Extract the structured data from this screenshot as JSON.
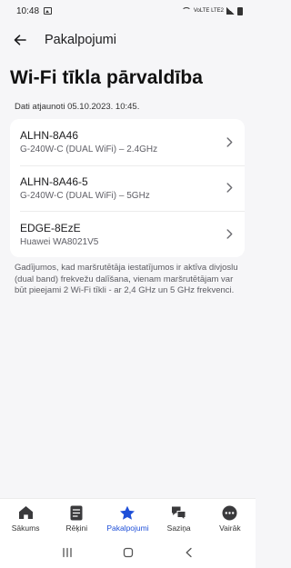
{
  "status_bar": {
    "time": "10:48",
    "network_label": "VoLTE LTE2"
  },
  "app_bar": {
    "title": "Pakalpojumi"
  },
  "page": {
    "title": "Wi-Fi tīkla pārvaldība",
    "updated": "Dati atjaunoti 05.10.2023. 10:45."
  },
  "networks": [
    {
      "name": "ALHN-8A46",
      "desc": "G-240W-C (DUAL WiFi) – 2.4GHz"
    },
    {
      "name": "ALHN-8A46-5",
      "desc": "G-240W-C (DUAL WiFi) – 5GHz"
    },
    {
      "name": "EDGE-8EzE",
      "desc": "Huawei WA8021V5"
    }
  ],
  "info_text": "Gadījumos, kad maršrutētāja iestatījumos ir aktīva divjoslu (dual band) frekvežu dalīšana, vienam maršrutētājam var būt pieejami 2 Wi-Fi tīkli - ar 2,4 GHz un 5 GHz frekvenci.",
  "bottom_nav": {
    "items": [
      {
        "label": "Sākums",
        "icon": "home-icon"
      },
      {
        "label": "Rēķini",
        "icon": "document-icon"
      },
      {
        "label": "Pakalpojumi",
        "icon": "star-icon",
        "active": true
      },
      {
        "label": "Saziņa",
        "icon": "chat-icon"
      },
      {
        "label": "Vairāk",
        "icon": "more-icon"
      }
    ]
  },
  "colors": {
    "accent": "#1e4fd8",
    "background": "#f6f6f8",
    "card": "#ffffff"
  }
}
